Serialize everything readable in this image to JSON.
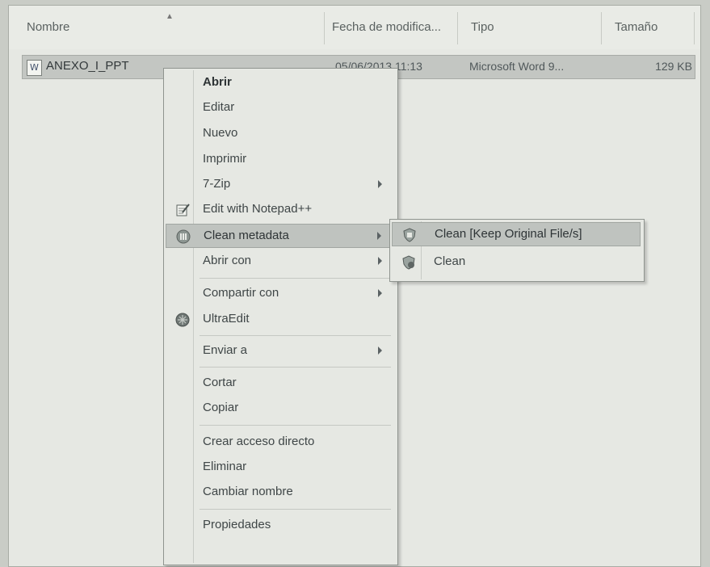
{
  "columns": {
    "name": "Nombre",
    "date": "Fecha de modifica...",
    "type": "Tipo",
    "size": "Tamaño"
  },
  "file": {
    "name": "ANEXO_I_PPT",
    "date": "05/06/2013 11:13",
    "type": "Microsoft Word 9...",
    "size": "129 KB",
    "icon": "word-document-icon"
  },
  "context_menu": {
    "items": [
      {
        "label": "Abrir"
      },
      {
        "label": "Editar"
      },
      {
        "label": "Nuevo"
      },
      {
        "label": "Imprimir"
      },
      {
        "label": "7-Zip"
      },
      {
        "label": "Edit with Notepad++",
        "icon": "notepad-icon"
      },
      {
        "label": "Clean metadata",
        "icon": "clean-metadata-icon"
      },
      {
        "label": "Abrir con"
      },
      {
        "label": "Compartir con"
      },
      {
        "label": "UltraEdit",
        "icon": "ultraedit-icon"
      },
      {
        "label": "Enviar a"
      },
      {
        "label": "Cortar"
      },
      {
        "label": "Copiar"
      },
      {
        "label": "Crear acceso directo"
      },
      {
        "label": "Eliminar"
      },
      {
        "label": "Cambiar nombre"
      },
      {
        "label": "Propiedades"
      }
    ]
  },
  "submenu": {
    "items": [
      {
        "label": "Clean [Keep Original File/s]",
        "icon": "shield-clean-icon"
      },
      {
        "label": "Clean",
        "icon": "shield-clean-icon"
      }
    ]
  }
}
